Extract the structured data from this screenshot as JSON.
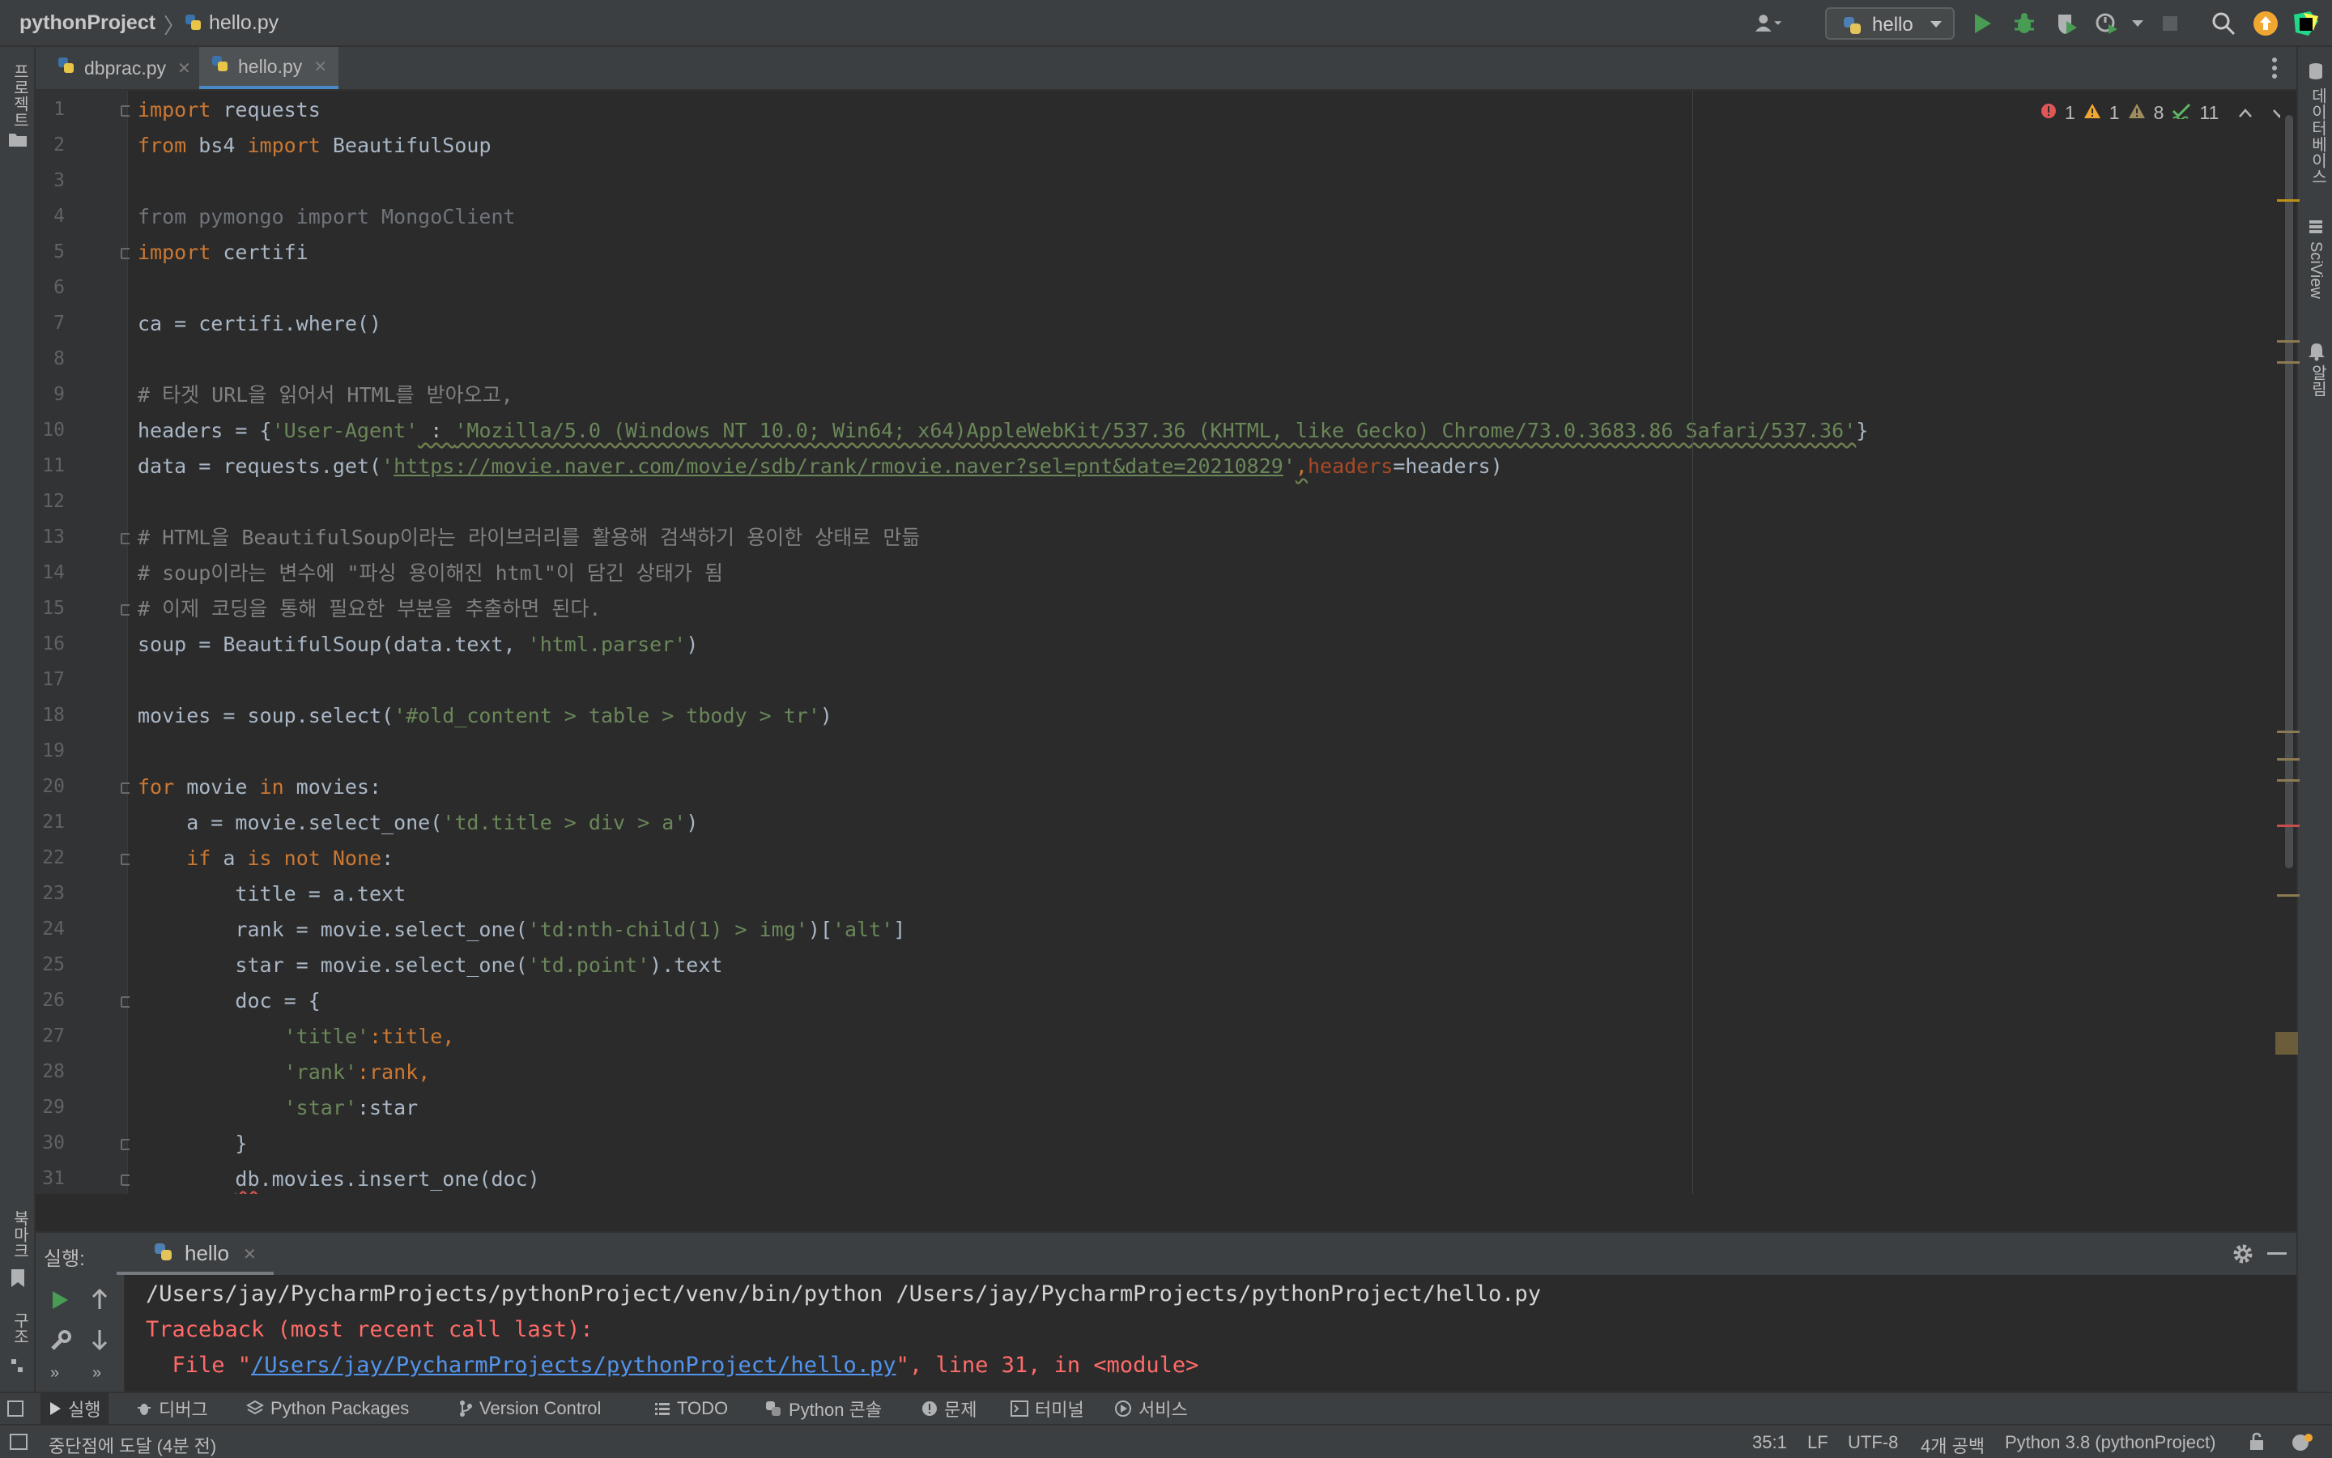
{
  "titlebar": {
    "project": "pythonProject",
    "separator": "〉",
    "file": "hello.py",
    "run_config": "hello"
  },
  "tabs": [
    {
      "label": "dbprac.py",
      "active": false
    },
    {
      "label": "hello.py",
      "active": true
    }
  ],
  "left_strip": {
    "project_label": "프로젝트",
    "bookmarks_label": "북마크",
    "structure_label": "구조"
  },
  "right_strip": {
    "database_label": "데이터베이스",
    "sciview_label": "SciView",
    "notifications_label": "알림"
  },
  "inspections": {
    "errors": "1",
    "warnings": "1",
    "weak_warnings": "8",
    "typos": "11"
  },
  "editor": {
    "line_numbers": [
      "1",
      "2",
      "3",
      "4",
      "5",
      "6",
      "7",
      "8",
      "9",
      "10",
      "11",
      "12",
      "13",
      "14",
      "15",
      "16",
      "17",
      "18",
      "19",
      "20",
      "21",
      "22",
      "23",
      "24",
      "25",
      "26",
      "27",
      "28",
      "29",
      "30",
      "31"
    ],
    "code": {
      "l1_kw": "import",
      "l1_rest": " requests",
      "l2_kw1": "from",
      "l2_mid": " bs4 ",
      "l2_kw2": "import",
      "l2_rest": " BeautifulSoup",
      "l4": "from pymongo import MongoClient",
      "l5_kw": "import",
      "l5_rest": " certifi",
      "l7": "ca = certifi.where()",
      "l9": "# 타겟 URL을 읽어서 HTML를 받아오고,",
      "l10_a": "headers = {",
      "l10_s1": "'User-Agent'",
      "l10_b": " : ",
      "l10_s2": "'Mozilla/5.0 (Windows NT 10.0; Win64; x64)AppleWebKit/537.36 (KHTML, like Gecko) Chrome/73.0.3683.86 Safari/537.36'",
      "l10_c": "}",
      "l11_a": "data = requests.get(",
      "l11_q1": "'",
      "l11_url": "https://movie.naver.com/movie/sdb/rank/rmovie.naver?sel=pnt&date=20210829",
      "l11_q2": "'",
      "l11_comma": ",",
      "l11_par": "headers",
      "l11_b": "=headers)",
      "l13": "# HTML을 BeautifulSoup이라는 라이브러리를 활용해 검색하기 용이한 상태로 만듦",
      "l14": "# soup이라는 변수에 \"파싱 용이해진 html\"이 담긴 상태가 됨",
      "l15": "# 이제 코딩을 통해 필요한 부분을 추출하면 된다.",
      "l16_a": "soup = BeautifulSoup(data.text, ",
      "l16_s": "'html.parser'",
      "l16_b": ")",
      "l18_a": "movies = soup.select(",
      "l18_s": "'#old_content > table > tbody > tr'",
      "l18_b": ")",
      "l20_kw1": "for",
      "l20_mid": " movie ",
      "l20_kw2": "in",
      "l20_rest": " movies:",
      "l21_a": "    a = movie.select_one(",
      "l21_s": "'td.title > div > a'",
      "l21_b": ")",
      "l22_pre": "    ",
      "l22_kw1": "if",
      "l22_mid": " a ",
      "l22_kw2": "is not None",
      "l22_rest": ":",
      "l23": "        title = a.text",
      "l24_a": "        rank = movie.select_one(",
      "l24_s1": "'td:nth-child(1) > img'",
      "l24_b": ")[",
      "l24_s2": "'alt'",
      "l24_c": "]",
      "l25_a": "        star = movie.select_one(",
      "l25_s": "'td.point'",
      "l25_b": ").text",
      "l26": "        doc = {",
      "l27_pre": "            ",
      "l27_s": "'title'",
      "l27_rest": ":title,",
      "l28_pre": "            ",
      "l28_s": "'rank'",
      "l28_rest": ":rank,",
      "l29_pre": "            ",
      "l29_s": "'star'",
      "l29_rest": ":star",
      "l30": "        }",
      "l31_pre": "        ",
      "l31_db": "db",
      "l31_rest": ".movies.insert_one(doc)"
    }
  },
  "run_panel": {
    "label": "실행:",
    "tab": "hello",
    "output": [
      "/Users/jay/PycharmProjects/pythonProject/venv/bin/python /Users/jay/PycharmProjects/pythonProject/hello.py",
      "Traceback (most recent call last):"
    ],
    "file_line_pre": "  File \"",
    "file_line_link": "/Users/jay/PycharmProjects/pythonProject/hello.py",
    "file_line_post": "\", line 31, in <module>"
  },
  "tool_tabs": [
    "실행",
    "디버그",
    "Python Packages",
    "Version Control",
    "TODO",
    "Python 콘솔",
    "문제",
    "터미널",
    "서비스"
  ],
  "status": {
    "message": "중단점에 도달 (4분 전)",
    "position": "35:1",
    "line_sep": "LF",
    "encoding": "UTF-8",
    "indent": "4개 공백",
    "interpreter": "Python 3.8 (pythonProject)"
  },
  "colors": {
    "keyword": "#cc7832",
    "string": "#6a8759",
    "comment": "#808080",
    "error": "#ff6b68",
    "link": "#5394ec",
    "run_green": "#499c54",
    "accent": "#4a88c7"
  }
}
